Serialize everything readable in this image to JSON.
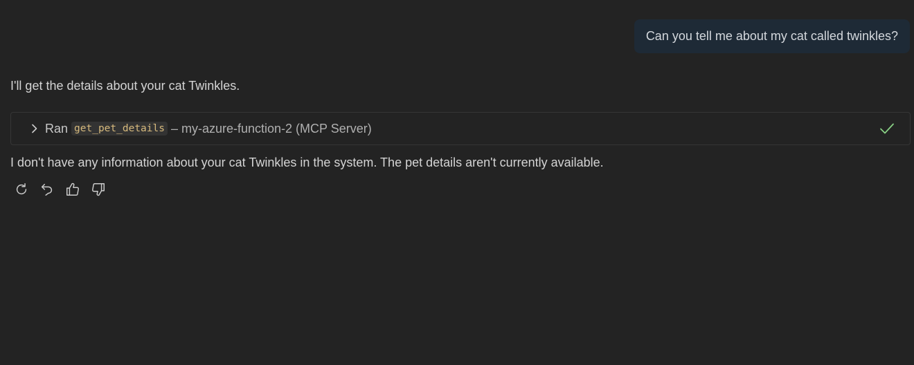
{
  "user_message": {
    "text": "Can you tell me about my cat called twinkles?"
  },
  "assistant": {
    "intro": "I'll get the details about your cat Twinkles.",
    "tool_call": {
      "prefix": "Ran",
      "tool_name": "get_pet_details",
      "server": "– my-azure-function-2 (MCP Server)",
      "status_icon": "checkmark-icon",
      "expand_icon": "chevron-right-icon"
    },
    "reply": "I don't have any information about your cat Twinkles in the system. The pet details aren't currently available.",
    "actions": [
      {
        "icon": "refresh-icon"
      },
      {
        "icon": "undo-icon"
      },
      {
        "icon": "thumbs-up-icon"
      },
      {
        "icon": "thumbs-down-icon"
      }
    ]
  },
  "colors": {
    "background": "#232323",
    "user_bubble": "#1e2a36",
    "tool_code_text": "#d7ba7d",
    "success_check": "#89d185"
  }
}
